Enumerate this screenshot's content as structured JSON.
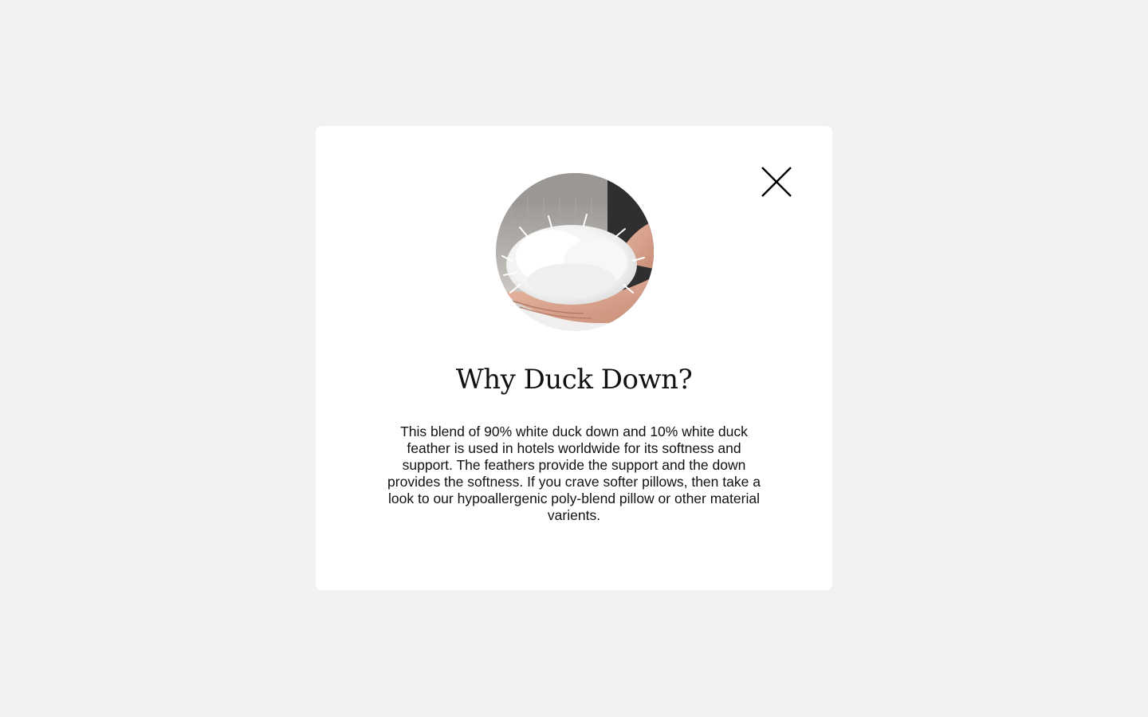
{
  "modal": {
    "title": "Why Duck Down?",
    "body": "This blend of 90% white duck down and 10% white duck feather is used in hotels worldwide for its softness and support. The feathers provide the support and the down provides the softness. If you crave softer pillows, then take a look to our hypoallergenic poly-blend pillow or other material varients.",
    "close_icon": "close-icon",
    "image_subject": "hand-holding-down-feathers"
  },
  "colors": {
    "page_background": "#f2f2f2",
    "modal_background": "#ffffff",
    "text": "#111111"
  }
}
